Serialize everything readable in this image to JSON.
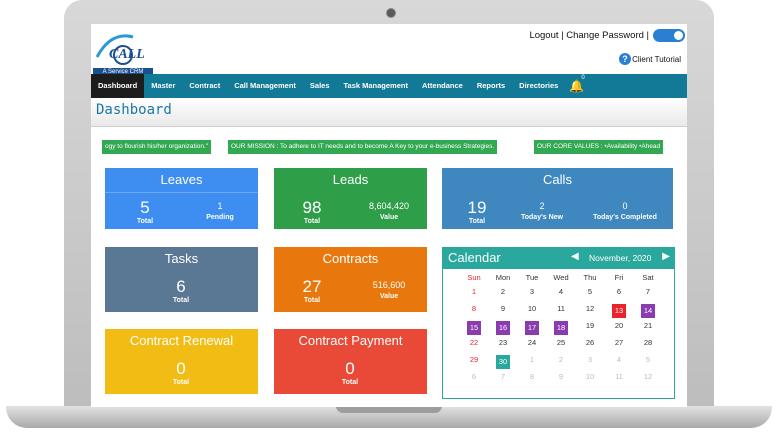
{
  "header": {
    "logo_text": "CALL",
    "logo_tagline": "A Service CRM",
    "links": "Logout | Change Password |",
    "client_tutorial": "Client Tutorial"
  },
  "nav": {
    "items": [
      "Dashboard",
      "Master",
      "Contract",
      "Call Management",
      "Sales",
      "Task Management",
      "Attendance",
      "Reports",
      "Directories"
    ],
    "notification_count": "0"
  },
  "page": {
    "title": "Dashboard"
  },
  "ticker": {
    "items": [
      "ogy to flourish his/her organization.\"",
      "OUR MISSION : To adhere to IT needs and to become A Key to your e-business Strategies.",
      "OUR CORE VALUES : •Availability •Ahead"
    ]
  },
  "cards": {
    "leaves": {
      "title": "Leaves",
      "v1": "5",
      "l1": "Total",
      "v2": "1",
      "l2": "Pending",
      "color": "#3d8ef0"
    },
    "leads": {
      "title": "Leads",
      "v1": "98",
      "l1": "Total",
      "v2": "8,604,420",
      "l2": "Value",
      "color": "#2e9e48"
    },
    "calls": {
      "title": "Calls",
      "v1": "19",
      "l1": "Total",
      "v2": "2",
      "l2": "Today's New",
      "v3": "0",
      "l3": "Today's Completed",
      "color": "#3e87bf"
    },
    "tasks": {
      "title": "Tasks",
      "v1": "6",
      "l1": "Total",
      "color": "#5a7794"
    },
    "contracts": {
      "title": "Contracts",
      "v1": "27",
      "l1": "Total",
      "v2": "516,600",
      "l2": "Value",
      "color": "#e8780e"
    },
    "contract_renewal": {
      "title": "Contract Renewal",
      "v1": "0",
      "l1": "Total",
      "color": "#f1bd14"
    },
    "contract_payment": {
      "title": "Contract Payment",
      "v1": "0",
      "l1": "Total",
      "color": "#e84a37"
    }
  },
  "calendar": {
    "title": "Calendar",
    "month": "November, 2020",
    "weekdays": [
      "Sun",
      "Mon",
      "Tue",
      "Wed",
      "Thu",
      "Fri",
      "Sat"
    ],
    "weeks": [
      [
        "1",
        "2",
        "3",
        "4",
        "5",
        "6",
        "7"
      ],
      [
        "8",
        "9",
        "10",
        "11",
        "12",
        "13",
        "14"
      ],
      [
        "15",
        "16",
        "17",
        "18",
        "19",
        "20",
        "21"
      ],
      [
        "22",
        "23",
        "24",
        "25",
        "26",
        "27",
        "28"
      ],
      [
        "29",
        "30",
        "1",
        "2",
        "3",
        "4",
        "5"
      ],
      [
        "6",
        "7",
        "8",
        "9",
        "10",
        "11",
        "12"
      ]
    ],
    "highlight_colors": {
      "red": "#e8232b",
      "purple": "#8a3bb0",
      "teal": "#2aa89d"
    }
  }
}
